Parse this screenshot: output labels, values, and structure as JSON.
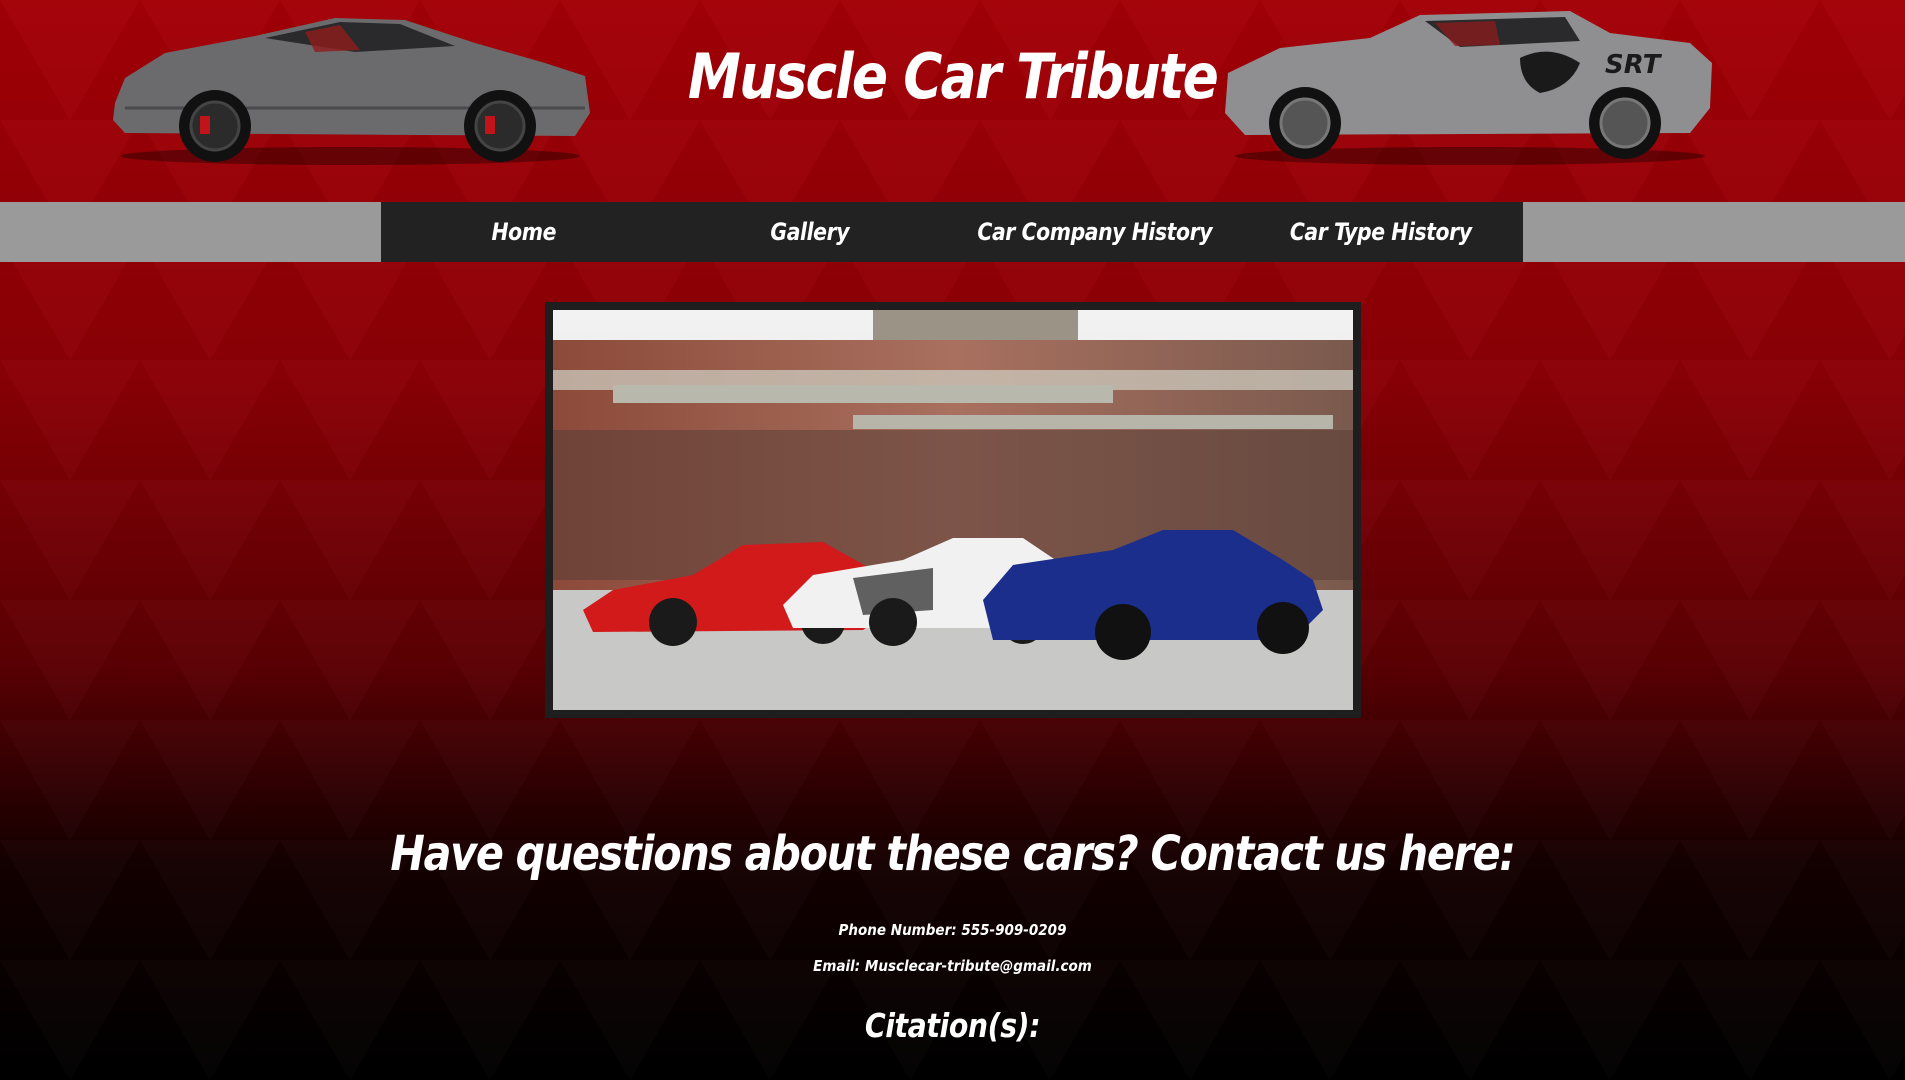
{
  "header": {
    "title": "Muscle Car Tribute",
    "left_car_icon": "gray-mustang-car-image",
    "right_car_icon": "gray-challenger-car-image"
  },
  "nav": {
    "items": [
      {
        "label": "Home"
      },
      {
        "label": "Gallery"
      },
      {
        "label": "Car Company History"
      },
      {
        "label": "Car Type History"
      }
    ]
  },
  "hero": {
    "image": "three-muscle-cars-photo"
  },
  "contact": {
    "heading": "Have questions about these cars? Contact us here:",
    "phone": "Phone Number: 555-909-0209",
    "email": "Email: Musclecar-tribute@gmail.com",
    "citation_heading": "Citation(s):"
  },
  "colors": {
    "background_top": "#a30007",
    "background_bottom": "#000000",
    "nav_bar": "#222223",
    "nav_side": "#9a9a9a",
    "text": "#ffffff"
  }
}
